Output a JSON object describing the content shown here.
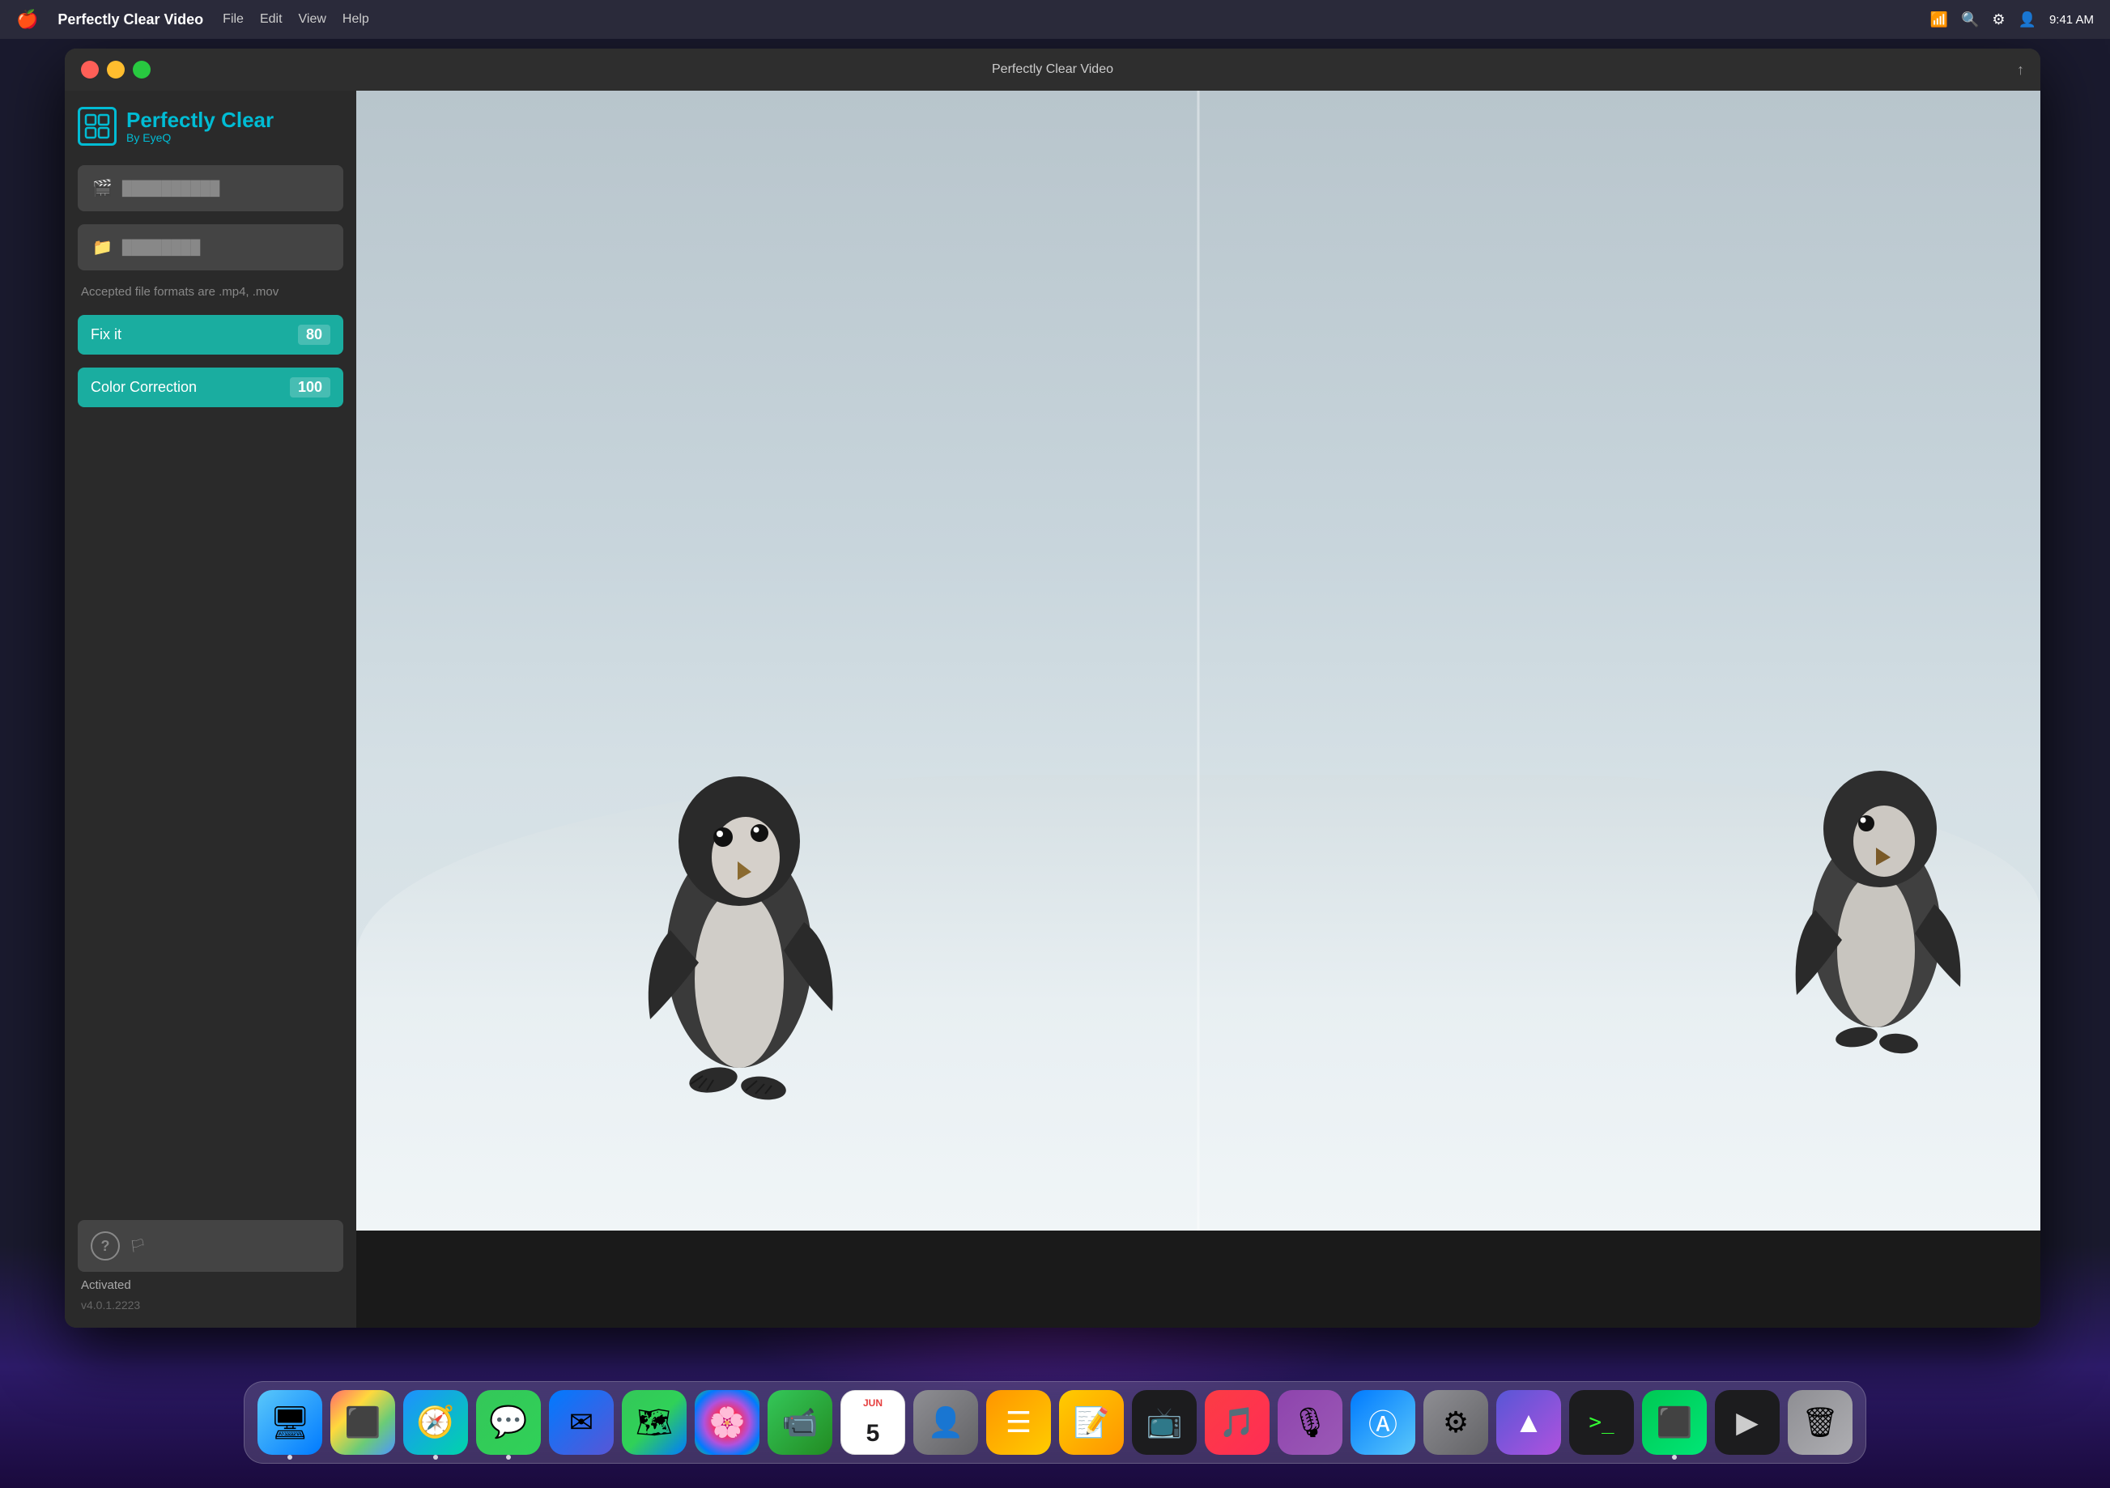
{
  "menubar": {
    "apple_icon": "🍎",
    "app_name": "Perfectly Clear Video",
    "right_icons": [
      "↑↓",
      "🔍",
      "⚙",
      "👤"
    ]
  },
  "window": {
    "title": "Perfectly Clear Video",
    "controls": {
      "close": "close",
      "minimize": "minimize",
      "maximize": "maximize"
    }
  },
  "sidebar": {
    "logo": {
      "title": "Perfectly Clear",
      "subtitle": "By EyeQ"
    },
    "import_video_label": "Import Video",
    "output_folder_label": "Output Folder",
    "file_formats_text": "Accepted file formats are .mp4, .mov",
    "fix_it": {
      "label": "Fix it",
      "value": "80"
    },
    "color_correction": {
      "label": "Color Correction",
      "value": "100"
    },
    "help_label": "Help",
    "status": "Activated",
    "version": "v4.0.1.2223"
  },
  "video": {
    "description": "Two baby emperor penguins on snow"
  },
  "dock": {
    "items": [
      {
        "name": "Finder",
        "class": "dock-finder",
        "icon": "🖥",
        "active": true
      },
      {
        "name": "Launchpad",
        "class": "dock-launchpad",
        "icon": "🚀",
        "active": false
      },
      {
        "name": "Safari",
        "class": "dock-safari",
        "icon": "🧭",
        "active": true
      },
      {
        "name": "Messages",
        "class": "dock-messages",
        "icon": "💬",
        "active": true
      },
      {
        "name": "Mail",
        "class": "dock-mail",
        "icon": "✉",
        "active": false
      },
      {
        "name": "Maps",
        "class": "dock-maps",
        "icon": "🗺",
        "active": false
      },
      {
        "name": "Photos",
        "class": "dock-photos",
        "icon": "🌸",
        "active": false
      },
      {
        "name": "FaceTime",
        "class": "dock-facetime",
        "icon": "📹",
        "active": false
      },
      {
        "name": "Calendar",
        "class": "dock-calendar",
        "icon": "",
        "month": "JUN",
        "day": "5",
        "active": false
      },
      {
        "name": "Contacts",
        "class": "dock-contacts",
        "icon": "👤",
        "active": false
      },
      {
        "name": "Reminders",
        "class": "dock-reminders",
        "icon": "☰",
        "active": false
      },
      {
        "name": "Notes",
        "class": "dock-notes",
        "icon": "📝",
        "active": false
      },
      {
        "name": "Apple TV",
        "class": "dock-appletv",
        "icon": "📺",
        "active": false
      },
      {
        "name": "Music",
        "class": "dock-music",
        "icon": "🎵",
        "active": false
      },
      {
        "name": "Podcasts",
        "class": "dock-podcasts",
        "icon": "🎙",
        "active": false
      },
      {
        "name": "App Store",
        "class": "dock-appstore",
        "icon": "Ⓐ",
        "active": false
      },
      {
        "name": "System Preferences",
        "class": "dock-systemprefs",
        "icon": "⚙",
        "active": false
      },
      {
        "name": "Altair",
        "class": "dock-altair",
        "icon": "▲",
        "active": false
      },
      {
        "name": "Terminal",
        "class": "dock-terminal",
        "icon": ">_",
        "active": false
      },
      {
        "name": "Screen Capture",
        "class": "dock-screencap",
        "icon": "⬛",
        "active": true
      },
      {
        "name": "WebM Player",
        "class": "dock-webm",
        "icon": "▶",
        "active": false
      },
      {
        "name": "Trash",
        "class": "dock-trash",
        "icon": "🗑",
        "active": false
      }
    ]
  }
}
